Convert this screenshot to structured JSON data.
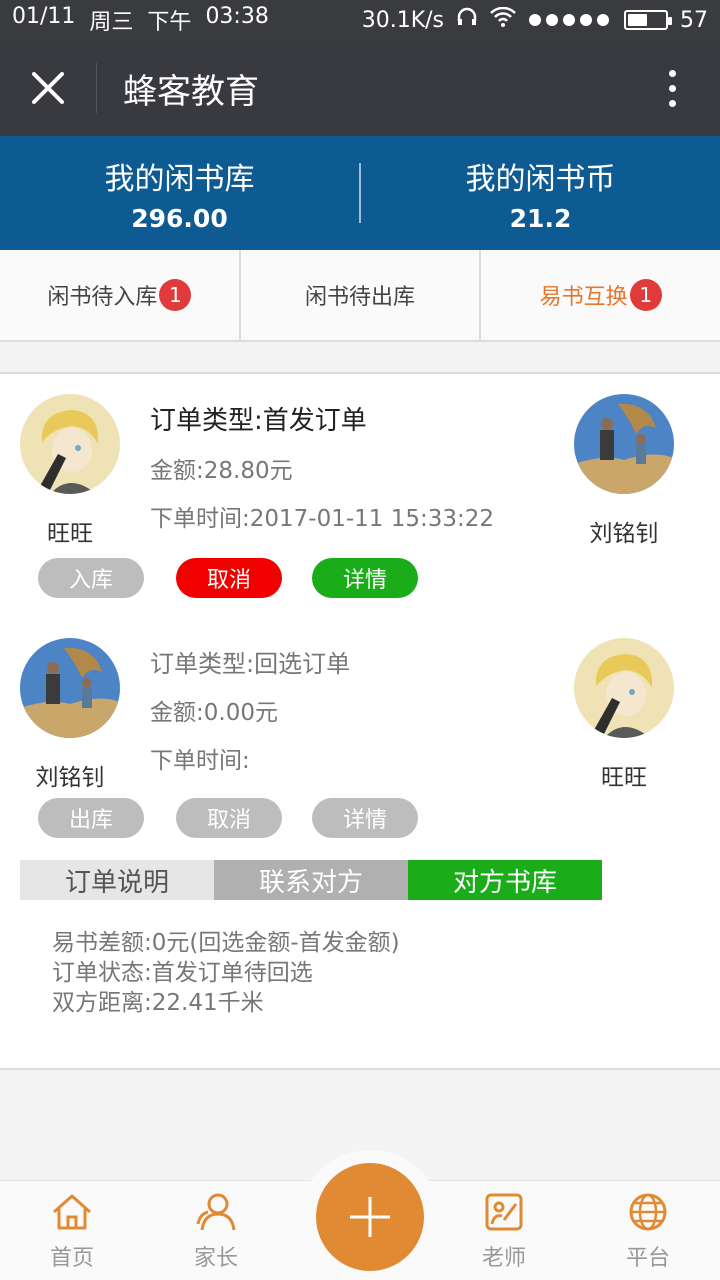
{
  "status_bar": {
    "date": "01/11",
    "weekday": "周三",
    "ampm": "下午",
    "time": "03:38",
    "network_speed": "30.1K/s",
    "battery": "57",
    "battery_level_percent": 57
  },
  "titlebar": {
    "title": "蜂客教育"
  },
  "stats": {
    "library_label": "我的闲书库",
    "library_value": "296.00",
    "coins_label": "我的闲书币",
    "coins_value": "21.2"
  },
  "tabs": [
    {
      "label": "闲书待入库",
      "badge": "1"
    },
    {
      "label": "闲书待出库",
      "badge": ""
    },
    {
      "label": "易书互换",
      "badge": "1"
    }
  ],
  "orders": [
    {
      "left_name": "旺旺",
      "right_name": "刘铭钊",
      "type": "订单类型:首发订单",
      "amount": "金额:28.80元",
      "time": "下单时间:2017-01-11 15:33:22",
      "buttons": [
        "入库",
        "取消",
        "详情"
      ]
    },
    {
      "left_name": "刘铭钊",
      "right_name": "旺旺",
      "type": "订单类型:回选订单",
      "amount": "金额:0.00元",
      "time": "下单时间:",
      "buttons": [
        "出库",
        "取消",
        "详情"
      ]
    }
  ],
  "subtabs": [
    "订单说明",
    "联系对方",
    "对方书库"
  ],
  "details": [
    "易书差额:0元(回选金额-首发金额)",
    "订单状态:首发订单待回选",
    "双方距离:22.41千米"
  ],
  "bottom_nav": {
    "home": "首页",
    "parent": "家长",
    "teacher": "老师",
    "platform": "平台"
  },
  "colors": {
    "accent_orange": "#e6762a",
    "banner_blue": "#0e5b93",
    "cancel_red": "#f10000",
    "confirm_green": "#1aad19",
    "fab_orange": "#e08a34"
  }
}
